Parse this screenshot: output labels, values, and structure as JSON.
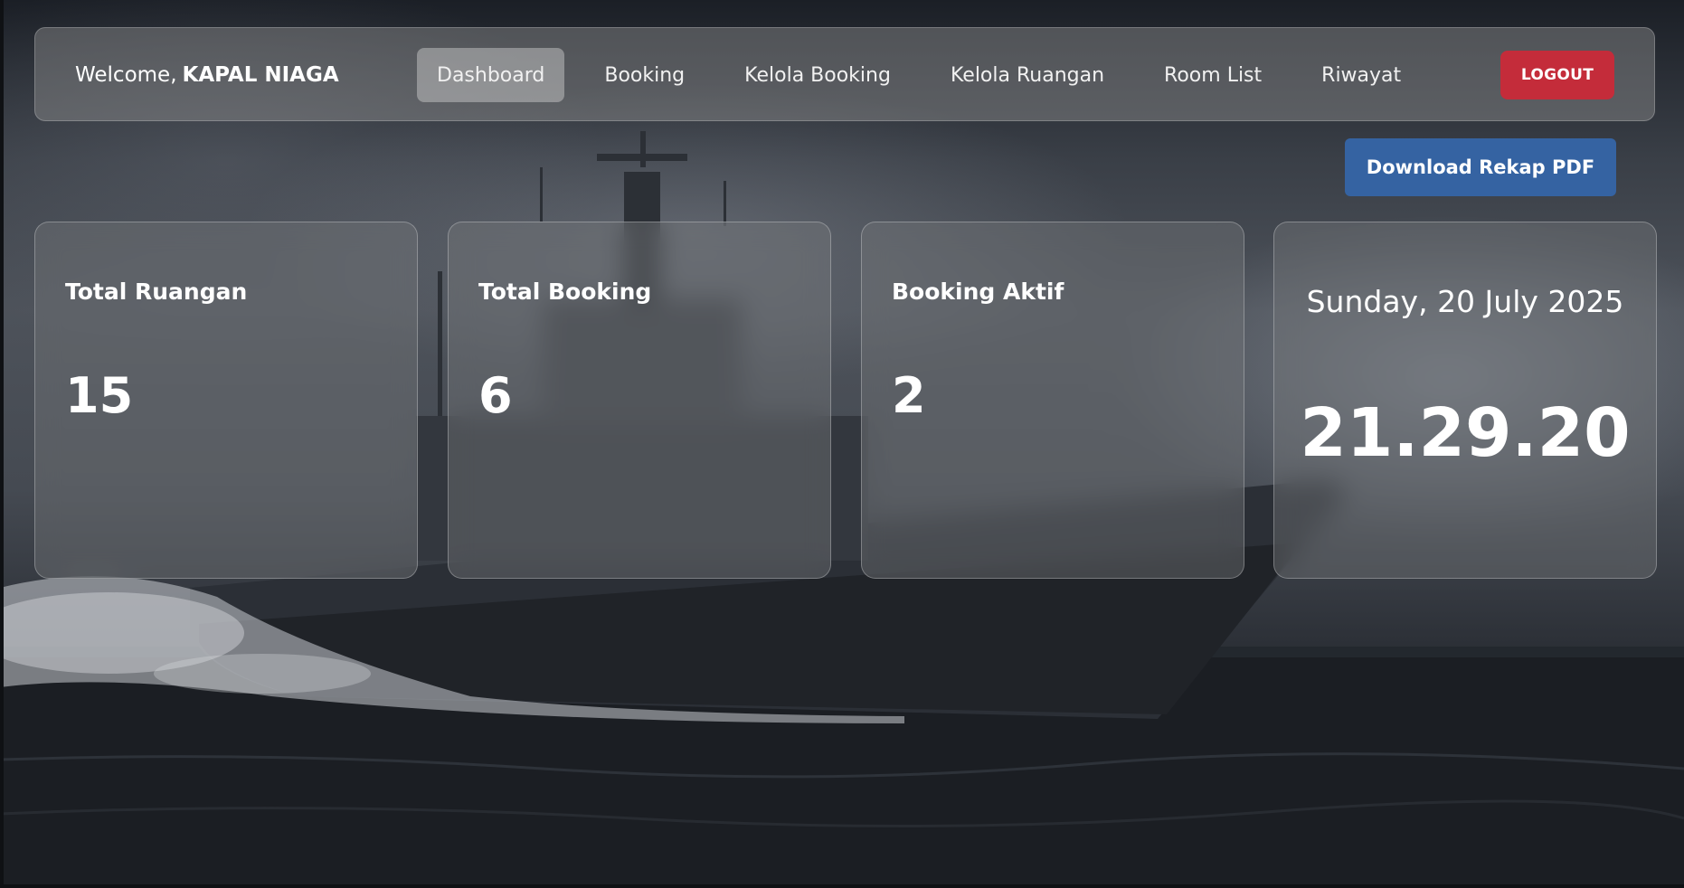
{
  "navbar": {
    "welcome_prefix": "Welcome,",
    "user_name": "KAPAL NIAGA",
    "links": [
      {
        "label": "Dashboard",
        "active": true
      },
      {
        "label": "Booking",
        "active": false
      },
      {
        "label": "Kelola Booking",
        "active": false
      },
      {
        "label": "Kelola Ruangan",
        "active": false
      },
      {
        "label": "Room List",
        "active": false
      },
      {
        "label": "Riwayat",
        "active": false
      }
    ],
    "logout_label": "LOGOUT"
  },
  "actions": {
    "download_label": "Download Rekap PDF"
  },
  "stats": [
    {
      "title": "Total Ruangan",
      "value": "15"
    },
    {
      "title": "Total Booking",
      "value": "6"
    },
    {
      "title": "Booking Aktif",
      "value": "2"
    }
  ],
  "clock": {
    "date": "Sunday, 20 July 2025",
    "time": "21.29.20"
  },
  "colors": {
    "logout_bg": "#c42c3a",
    "download_bg": "#3563a2",
    "active_tab_bg": "#b4b4b4"
  }
}
